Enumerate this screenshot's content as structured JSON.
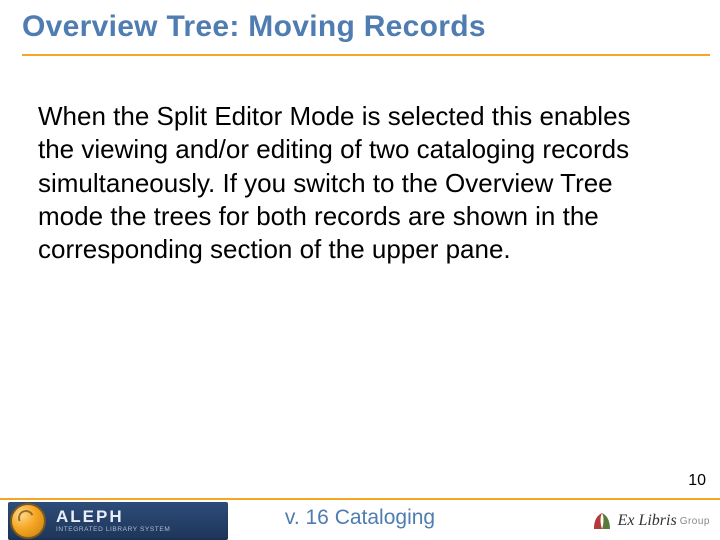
{
  "title": "Overview Tree: Moving Records",
  "body": "When the Split Editor Mode is selected this enables the viewing and/or editing of two cataloging records simultaneously. If you switch to the Overview Tree mode the trees for both records are shown in the corresponding section of the upper pane.",
  "footer": {
    "center": "v. 16 Cataloging",
    "page_number": "10",
    "aleph": {
      "name": "ALEPH",
      "subtitle": "INTEGRATED LIBRARY SYSTEM"
    },
    "exlibris": {
      "name": "Ex Libris",
      "group": "Group"
    }
  }
}
